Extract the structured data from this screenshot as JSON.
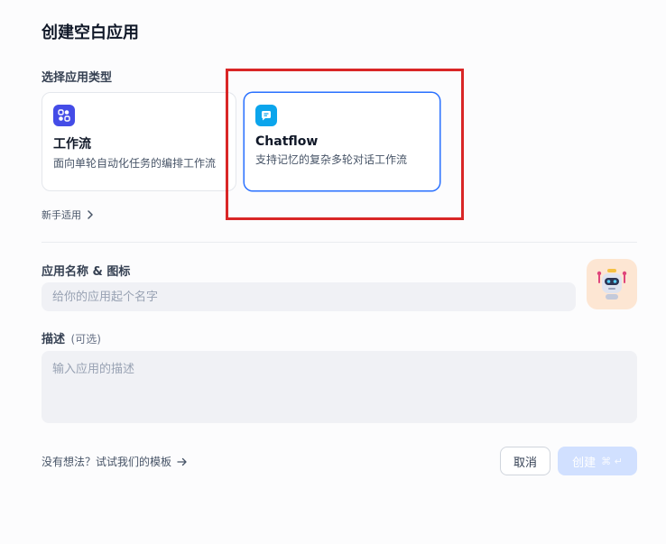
{
  "dialog": {
    "title": "创建空白应用",
    "type_section_label": "选择应用类型",
    "app_types": [
      {
        "name": "工作流",
        "description": "面向单轮自动化任务的编排工作流",
        "icon": "workflow-icon",
        "color": "#444ce7",
        "selected": false
      },
      {
        "name": "Chatflow",
        "description": "支持记忆的复杂多轮对话工作流",
        "icon": "chatflow-icon",
        "color": "#0ba5ec",
        "selected": true
      }
    ],
    "beginner_link": "新手适用",
    "name_section_label": "应用名称 & 图标",
    "name_placeholder": "给你的应用起个名字",
    "app_icon": "robot-icon",
    "desc_section_label": "描述",
    "desc_optional": "(可选)",
    "desc_placeholder": "输入应用的描述",
    "template_link": "没有想法？试试我们的模板",
    "cancel_label": "取消",
    "create_label": "创建",
    "create_shortcut": "⌘ ↵",
    "accent_color": "#2970ff",
    "highlight_color": "#d92626"
  }
}
